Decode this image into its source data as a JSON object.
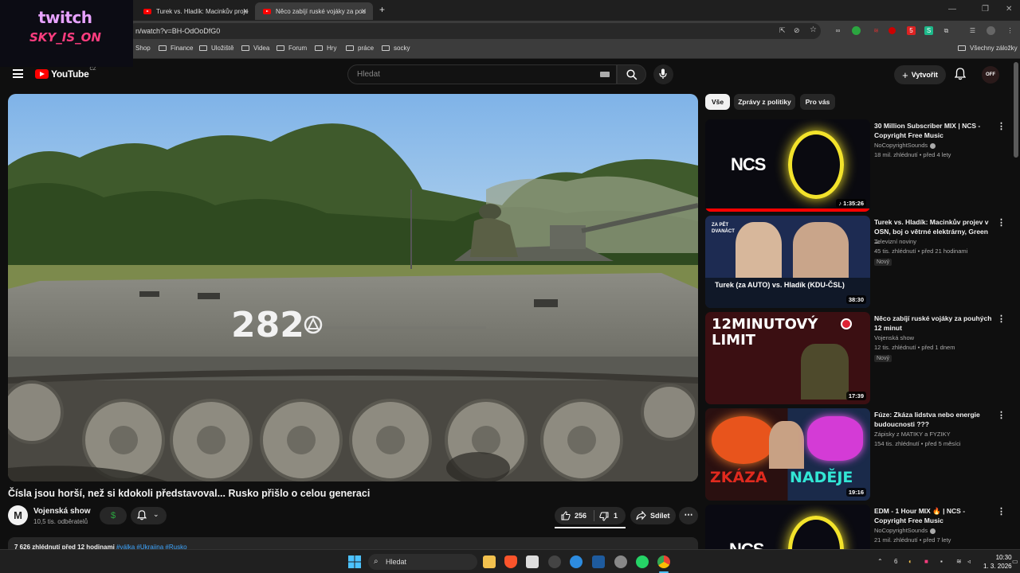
{
  "browser": {
    "tabs": [
      {
        "title": "Turek vs. Hladík: Macinkův proje"
      },
      {
        "title": "Něco zabíjí ruské vojáky za pou"
      }
    ],
    "new_tab": "+",
    "url": "n/watch?v=BH-OdOoDfG0",
    "bookmarks": [
      "Shop",
      "Finance",
      "Uložiště",
      "Videa",
      "Forum",
      "Hry",
      "práce",
      "socky"
    ],
    "all_bookmarks": "Všechny záložky"
  },
  "overlay": {
    "line1": "twitch",
    "line2": "SKY_IS_ON"
  },
  "youtube": {
    "logo": "YouTube",
    "country": "CZ",
    "search_placeholder": "Hledat",
    "create_label": "Vytvořit",
    "avatar_text": "OFF"
  },
  "video": {
    "title": "Čísla jsou horší, než si kdokoli představoval... Rusko přišlo o celou generaci",
    "channel": "Vojenská show",
    "channel_initial": "M",
    "subscribers": "10,5 tis. odběratelů",
    "join_symbol": "$",
    "likes": "256",
    "dislikes": "1",
    "share_label": "Sdílet",
    "more_label": "⋯",
    "description_meta": "7 626 zhlédnutí  před 12 hodinami",
    "description_tags": "#válka #Ukrajina #Rusko",
    "vehicle_number": "282"
  },
  "chips": [
    {
      "label": "Vše",
      "selected": true
    },
    {
      "label": "Zprávy z politiky",
      "selected": false
    },
    {
      "label": "Pro vás",
      "selected": false
    }
  ],
  "recommendations": [
    {
      "title": "30 Million Subscriber MIX | NCS - Copyright Free Music",
      "channel": "NoCopyrightSounds",
      "meta": "18 mil. zhlédnutí • před 4 lety",
      "duration": "♪ 1:35:26",
      "thumb_text": "NCS",
      "badge": ""
    },
    {
      "title": "Turek vs. Hladík: Macinkův projev v OSN, boj o větrné elektrárny, Green ...",
      "channel": "Televizní noviny",
      "meta": "45 tis. zhlédnutí • před 21 hodinami",
      "duration": "38:30",
      "thumb_text": "Turek (za AUTO) vs. Hladík (KDU-ČSL)",
      "thumb_tag": "ZA PĚT DVANÁCT",
      "badge": "Nový"
    },
    {
      "title": "Něco zabíjí ruské vojáky za pouhých 12 minut",
      "channel": "Vojenská show",
      "meta": "12 tis. zhlédnutí • před 1 dnem",
      "duration": "17:39",
      "thumb_text": "12MINUTOVÝ LIMIT",
      "badge": "Nový"
    },
    {
      "title": "Fúze: Zkáza lidstva nebo energie budoucnosti ???",
      "channel": "Zápisky z MATIKY a FYZIKY",
      "meta": "154 tis. zhlédnutí • před 5 měsíci",
      "duration": "19:16",
      "thumb_text_a": "ZKÁZA",
      "thumb_text_b": "NADĚJE",
      "badge": ""
    },
    {
      "title": "EDM - 1 Hour MIX 🔥 | NCS - Copyright Free Music",
      "channel": "NoCopyrightSounds",
      "meta": "21 mil. zhlédnutí • před 7 lety",
      "duration": "",
      "thumb_text": "NCS",
      "badge": ""
    }
  ],
  "taskbar": {
    "search_placeholder": "Hledat",
    "time": "10:30",
    "date": "1. 3. 2026",
    "tray_num": "6"
  },
  "colors": {
    "brand_red": "#ff0000",
    "link_blue": "#3ea6ff",
    "bg": "#0f0f0f"
  }
}
